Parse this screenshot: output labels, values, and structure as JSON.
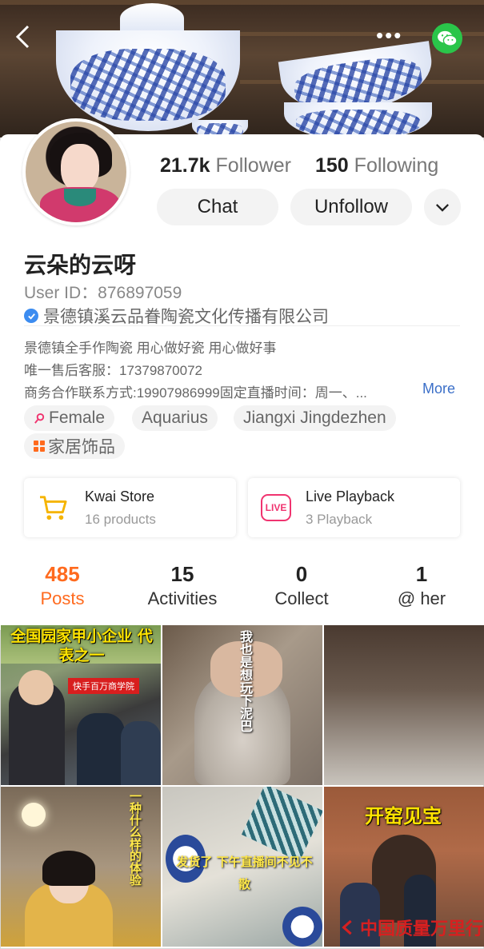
{
  "header": {
    "back_icon": "back-arrow-icon",
    "more_icon": "more-dots-icon",
    "share_icon": "wechat-icon",
    "more_glyph": "•••"
  },
  "profile": {
    "followers_count": "21.7k",
    "followers_label": "Follower",
    "following_count": "150",
    "following_label": "Following",
    "chat_label": "Chat",
    "unfollow_label": "Unfollow",
    "name": "云朵的云呀",
    "user_id": "User ID：876897059",
    "verified_org": "景德镇溪云品眷陶瓷文化传播有限公司",
    "bio_lines": [
      "景德镇全手作陶瓷 用心做好瓷 用心做好事",
      "唯一售后客服：17379870072",
      "商务合作联系方式:19907986999固定直播时间：周一、..."
    ],
    "more_label": "More"
  },
  "tags": [
    {
      "label": "Female",
      "icon": "female-icon"
    },
    {
      "label": "Aquarius"
    },
    {
      "label": "Jiangxi Jingdezhen"
    },
    {
      "label": "家居饰品",
      "icon": "category-grid-icon"
    }
  ],
  "shop_cards": [
    {
      "title": "Kwai Store",
      "subtitle": "16 products",
      "icon": "cart-icon"
    },
    {
      "title": "Live Playback",
      "subtitle": "3 Playback",
      "icon": "live-icon",
      "icon_text": "LIVE"
    }
  ],
  "tabs": [
    {
      "count": "485",
      "label": "Posts",
      "active": true
    },
    {
      "count": "15",
      "label": "Activities"
    },
    {
      "count": "0",
      "label": "Collect"
    },
    {
      "count": "1",
      "label": "@ her"
    }
  ],
  "posts": [
    {
      "caption": "全国园家甲小企业 代表之一",
      "sub": "快手百万商学院"
    },
    {
      "caption": "我也是想玩下泥巴"
    },
    {
      "caption": ""
    },
    {
      "caption": "一种什么样的体验"
    },
    {
      "caption": "发货了 下午直播间不见不散"
    },
    {
      "caption": "开窑见宝"
    }
  ],
  "watermark": "中国质量万里行",
  "colors": {
    "accent": "#ff6a1e",
    "link": "#3b6fc8",
    "wechat": "#2ac54a",
    "live": "#f0336f",
    "verified": "#3c8cf0"
  }
}
